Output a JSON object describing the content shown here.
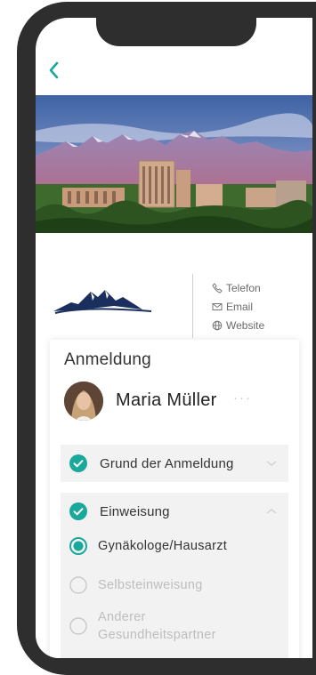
{
  "nav": {
    "back_icon": "chevron-left-icon"
  },
  "contact": {
    "items": [
      {
        "icon": "phone-icon",
        "label": "Telefon"
      },
      {
        "icon": "mail-icon",
        "label": "Email"
      },
      {
        "icon": "globe-icon",
        "label": "Website"
      }
    ]
  },
  "registration": {
    "title": "Anmeldung",
    "user": {
      "name": "Maria Müller",
      "more": "···"
    },
    "sections": [
      {
        "label": "Grund der Anmeldung",
        "completed": true,
        "expanded": false
      },
      {
        "label": "Einweisung",
        "completed": true,
        "expanded": true
      }
    ],
    "referral_options": [
      {
        "label": "Gynäkologe/Hausarzt",
        "selected": true
      },
      {
        "label": "Selbsteinweisung",
        "selected": false
      },
      {
        "label": "Anderer Gesundheitspartner",
        "selected": false
      }
    ]
  },
  "colors": {
    "accent": "#19a89a",
    "logo": "#1b2f5e",
    "panel": "#f2f2f2"
  }
}
